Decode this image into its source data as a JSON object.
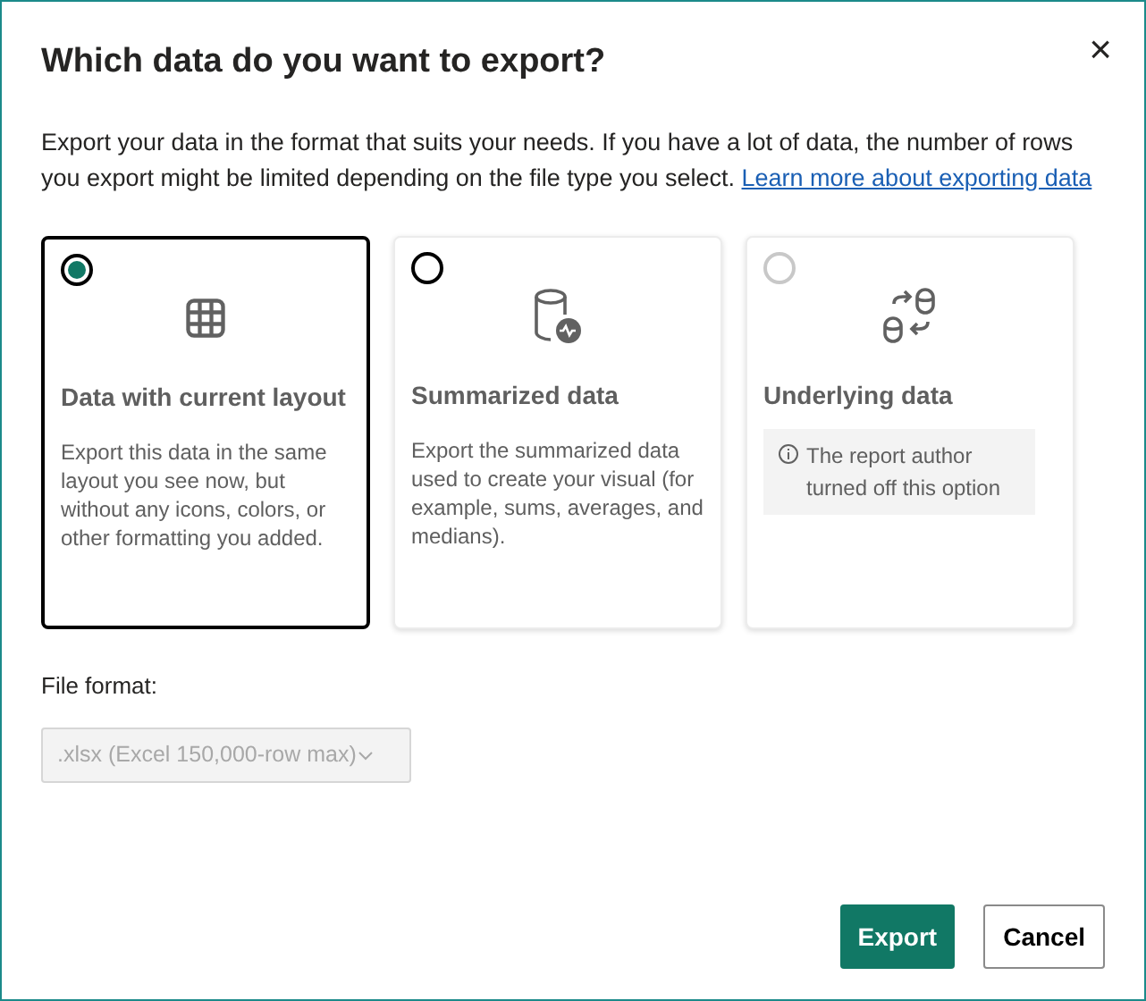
{
  "dialog": {
    "title": "Which data do you want to export?",
    "close": "×",
    "intro": "Export your data in the format that suits your needs. If you have a lot of data, the number of rows you export might be limited depending on the file type you select.",
    "link": "Learn more about exporting data"
  },
  "options": [
    {
      "title": "Data with current layout",
      "kind": "description",
      "text": "Export this data in the same layout you see now, but without any icons, colors, or other formatting you added.",
      "selected": true,
      "disabled": false
    },
    {
      "title": "Summarized data",
      "kind": "description",
      "text": "Export the summarized data used to create your visual (for example, sums, averages, and medians).",
      "selected": false,
      "disabled": false
    },
    {
      "title": "Underlying data",
      "kind": "notice",
      "text": "The report author turned off this option",
      "selected": false,
      "disabled": true
    }
  ],
  "file_format": {
    "label": "File format:",
    "value": ".xlsx (Excel 150,000-row max)",
    "disabled": true
  },
  "buttons": [
    {
      "label": "Export",
      "kind": "primary"
    },
    {
      "label": "Cancel",
      "kind": "secondary"
    }
  ]
}
